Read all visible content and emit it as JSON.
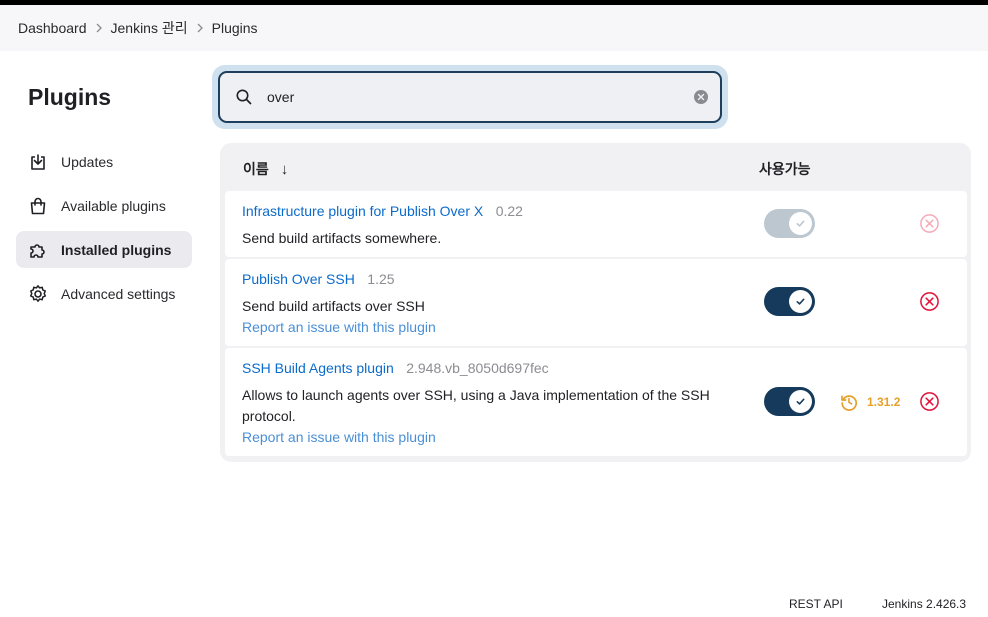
{
  "breadcrumb": {
    "items": [
      "Dashboard",
      "Jenkins 관리",
      "Plugins"
    ]
  },
  "page": {
    "title": "Plugins"
  },
  "sidebar": {
    "items": [
      {
        "label": "Updates",
        "icon": "download-icon",
        "active": false
      },
      {
        "label": "Available plugins",
        "icon": "shopping-bag-icon",
        "active": false
      },
      {
        "label": "Installed plugins",
        "icon": "puzzle-piece-icon",
        "active": true
      },
      {
        "label": "Advanced settings",
        "icon": "gear-icon",
        "active": false
      }
    ]
  },
  "search": {
    "value": "over",
    "placeholder": ""
  },
  "table": {
    "columns": {
      "name": "이름",
      "sort_indicator": "↓",
      "enabled": "사용가능"
    },
    "rows": [
      {
        "name": "Infrastructure plugin for Publish Over X",
        "version": "0.22",
        "description": "Send build artifacts somewhere.",
        "report_link": "",
        "enabled": true,
        "toggle_disabled": true,
        "uninstall_disabled": true,
        "downgrade": ""
      },
      {
        "name": "Publish Over SSH",
        "version": "1.25",
        "description": "Send build artifacts over SSH",
        "report_link": "Report an issue with this plugin",
        "enabled": true,
        "toggle_disabled": false,
        "uninstall_disabled": false,
        "downgrade": ""
      },
      {
        "name": "SSH Build Agents plugin",
        "version": "2.948.vb_8050d697fec",
        "description_line1": "Allows to launch agents over SSH, using a Java implementation of the SSH",
        "description_line2": "protocol.",
        "report_link": "Report an issue with this plugin",
        "enabled": true,
        "toggle_disabled": false,
        "uninstall_disabled": false,
        "downgrade": "1.31.2"
      }
    ]
  },
  "footer": {
    "rest_api": "REST API",
    "version": "Jenkins 2.426.3"
  },
  "colors": {
    "link": "#0b6bcb",
    "toggle_on": "#153a5c",
    "toggle_disabled": "#bcc7d0",
    "danger": "#e0153a",
    "warning": "#e6a02a",
    "search_focus_ring": "#cfe0ee"
  }
}
